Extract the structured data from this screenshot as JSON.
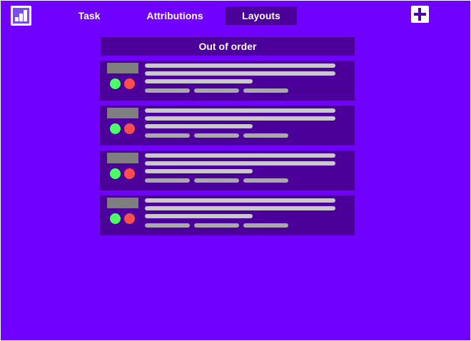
{
  "nav": {
    "logo_icon": "bar-chart-icon",
    "tabs": [
      {
        "label": "Task",
        "active": false
      },
      {
        "label": "Attributions",
        "active": false
      },
      {
        "label": "Layouts",
        "active": true
      }
    ],
    "add_icon": "plus-icon"
  },
  "section": {
    "title": "Out of order"
  },
  "cards": [
    {
      "status": [
        "green",
        "red"
      ]
    },
    {
      "status": [
        "green",
        "red"
      ]
    },
    {
      "status": [
        "green",
        "red"
      ]
    },
    {
      "status": [
        "green",
        "red"
      ]
    }
  ],
  "colors": {
    "background": "#7000ff",
    "panel": "#4a0099",
    "placeholder_line": "#c9c9c9",
    "placeholder_chip": "#a9a9a9",
    "thumbnail": "#7f7f7f",
    "status_green": "#4dff66",
    "status_red": "#ff4d4d"
  }
}
